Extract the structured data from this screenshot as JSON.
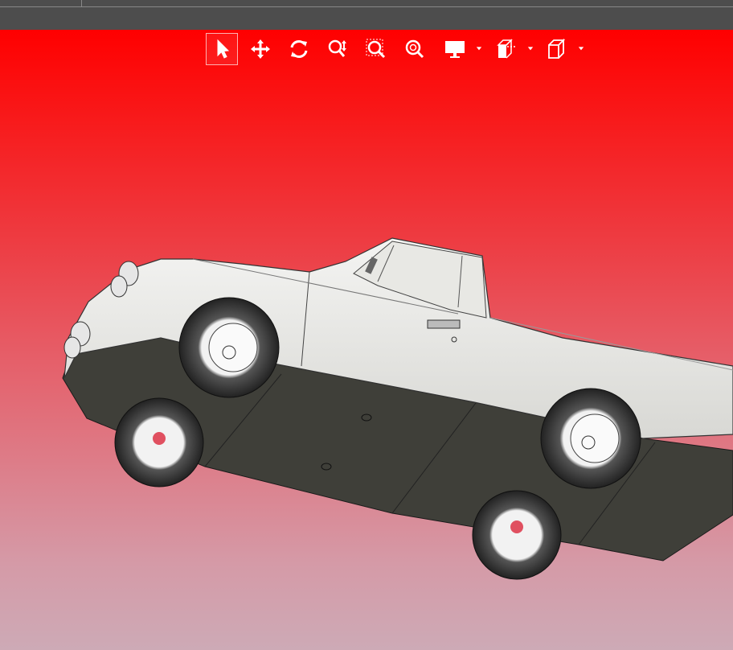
{
  "app": {
    "accent": "#ff0000",
    "topbar_color": "#4d4d4d"
  },
  "toolbar": {
    "items": [
      {
        "name": "select-tool",
        "icon": "arrow-cursor-icon",
        "active": true
      },
      {
        "name": "pan-tool",
        "icon": "move-arrows-icon",
        "active": false
      },
      {
        "name": "rotate-tool",
        "icon": "rotate-icon",
        "active": false
      },
      {
        "name": "zoom-tool",
        "icon": "zoom-in-out-icon",
        "active": false
      },
      {
        "name": "zoom-window-tool",
        "icon": "zoom-window-icon",
        "active": false
      },
      {
        "name": "zoom-fit-tool",
        "icon": "zoom-fit-icon",
        "active": false
      },
      {
        "name": "display-mode-dropdown",
        "icon": "monitor-icon",
        "active": false
      },
      {
        "name": "section-view-dropdown",
        "icon": "section-box-icon",
        "active": false
      },
      {
        "name": "view-orientation-dropdown",
        "icon": "cube-icon",
        "active": false
      }
    ]
  },
  "viewport": {
    "background_top": "#ff0000",
    "background_bottom": "#cdaab6",
    "model": "pickup-truck-3d-model"
  }
}
